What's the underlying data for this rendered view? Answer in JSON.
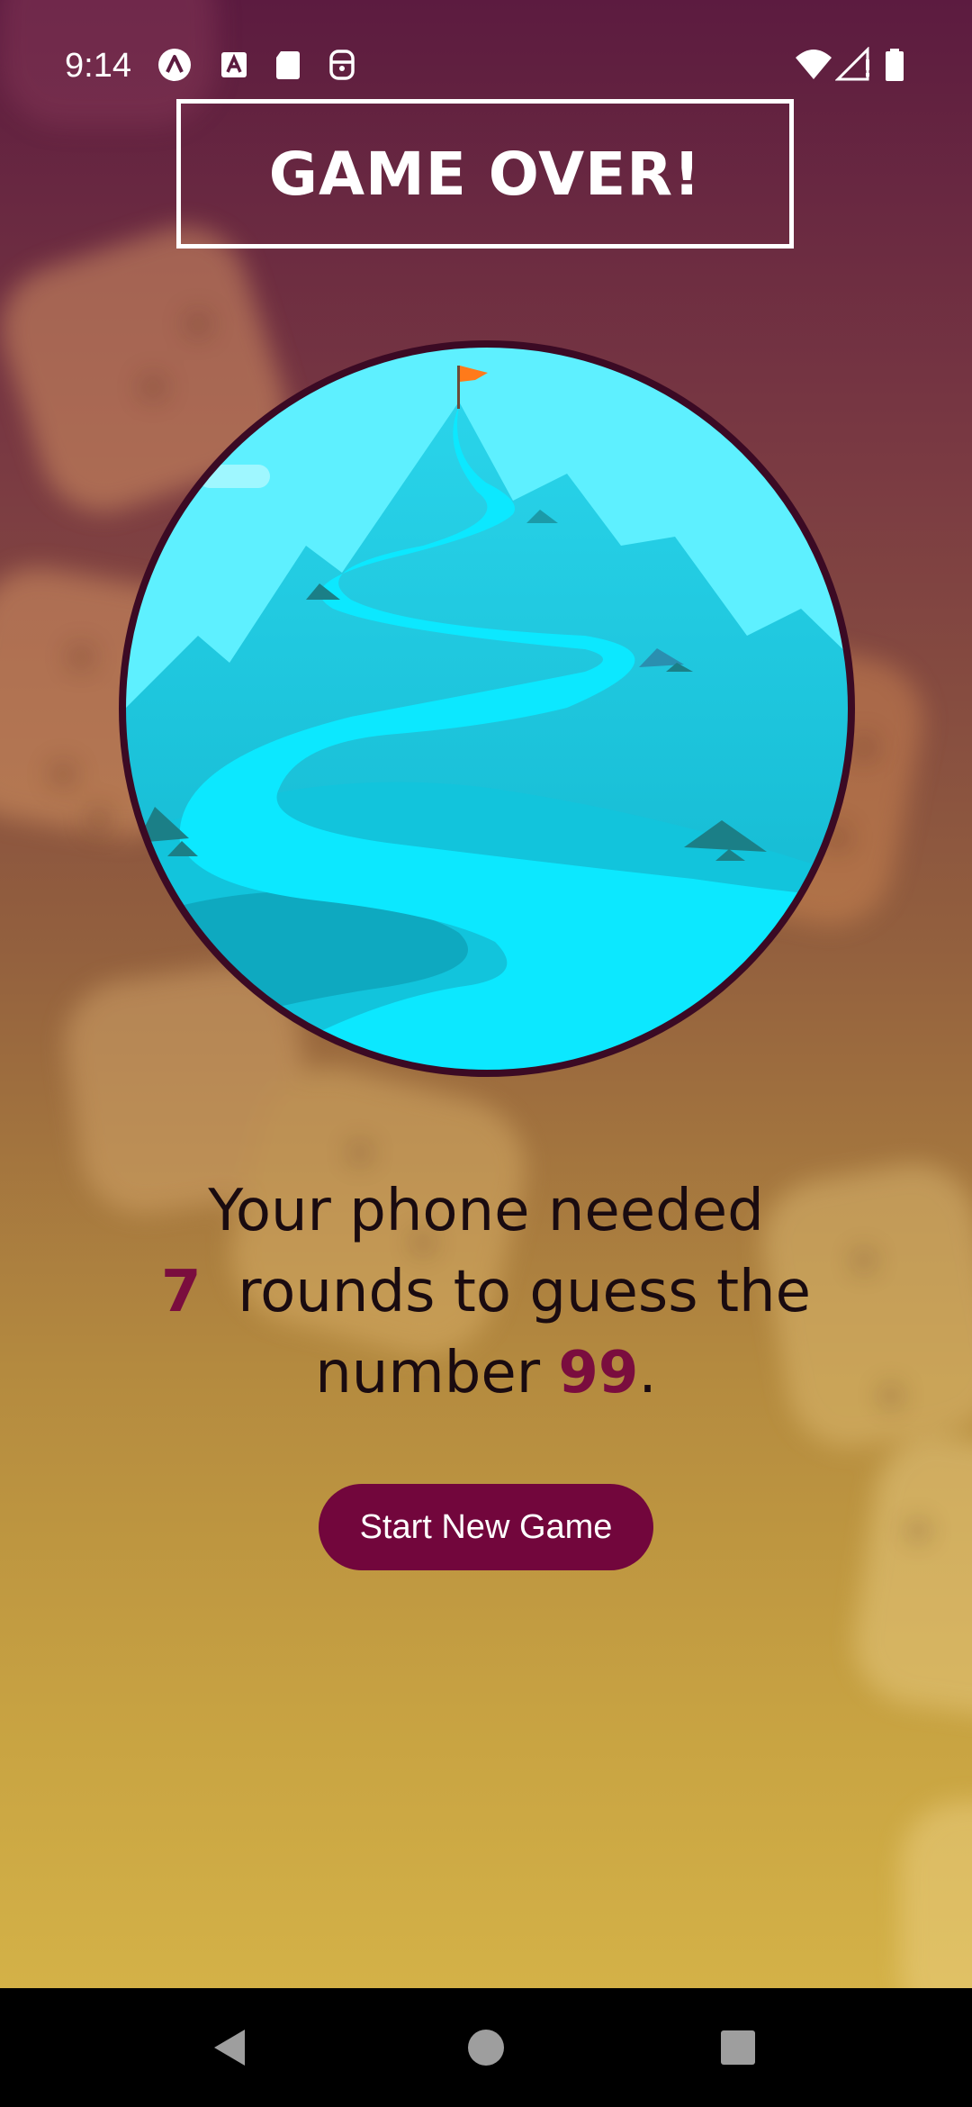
{
  "status_bar": {
    "time": "9:14",
    "left_icons": [
      "app-a-circle-icon",
      "text-a-icon",
      "sd-card-icon",
      "accessibility-icon"
    ],
    "right_icons": [
      "wifi-icon",
      "signal-icon",
      "battery-icon"
    ]
  },
  "screen": {
    "title": "GAME OVER!",
    "illustration": "mountain-summit-illustration",
    "summary": {
      "part1": "Your phone needed",
      "rounds": "7",
      "part2": "rounds to guess the number",
      "number": "99",
      "end": "."
    },
    "start_button_label": "Start New Game"
  },
  "colors": {
    "accent": "#72063c",
    "highlight_text": "#7a0d3e",
    "bg_top": "#5c1b40",
    "bg_bottom": "#d9b84a",
    "sky": "#5ef0ff",
    "ring": "#3b0a24"
  },
  "nav_bar": {
    "buttons": [
      "back-icon",
      "home-icon",
      "recents-icon"
    ]
  }
}
